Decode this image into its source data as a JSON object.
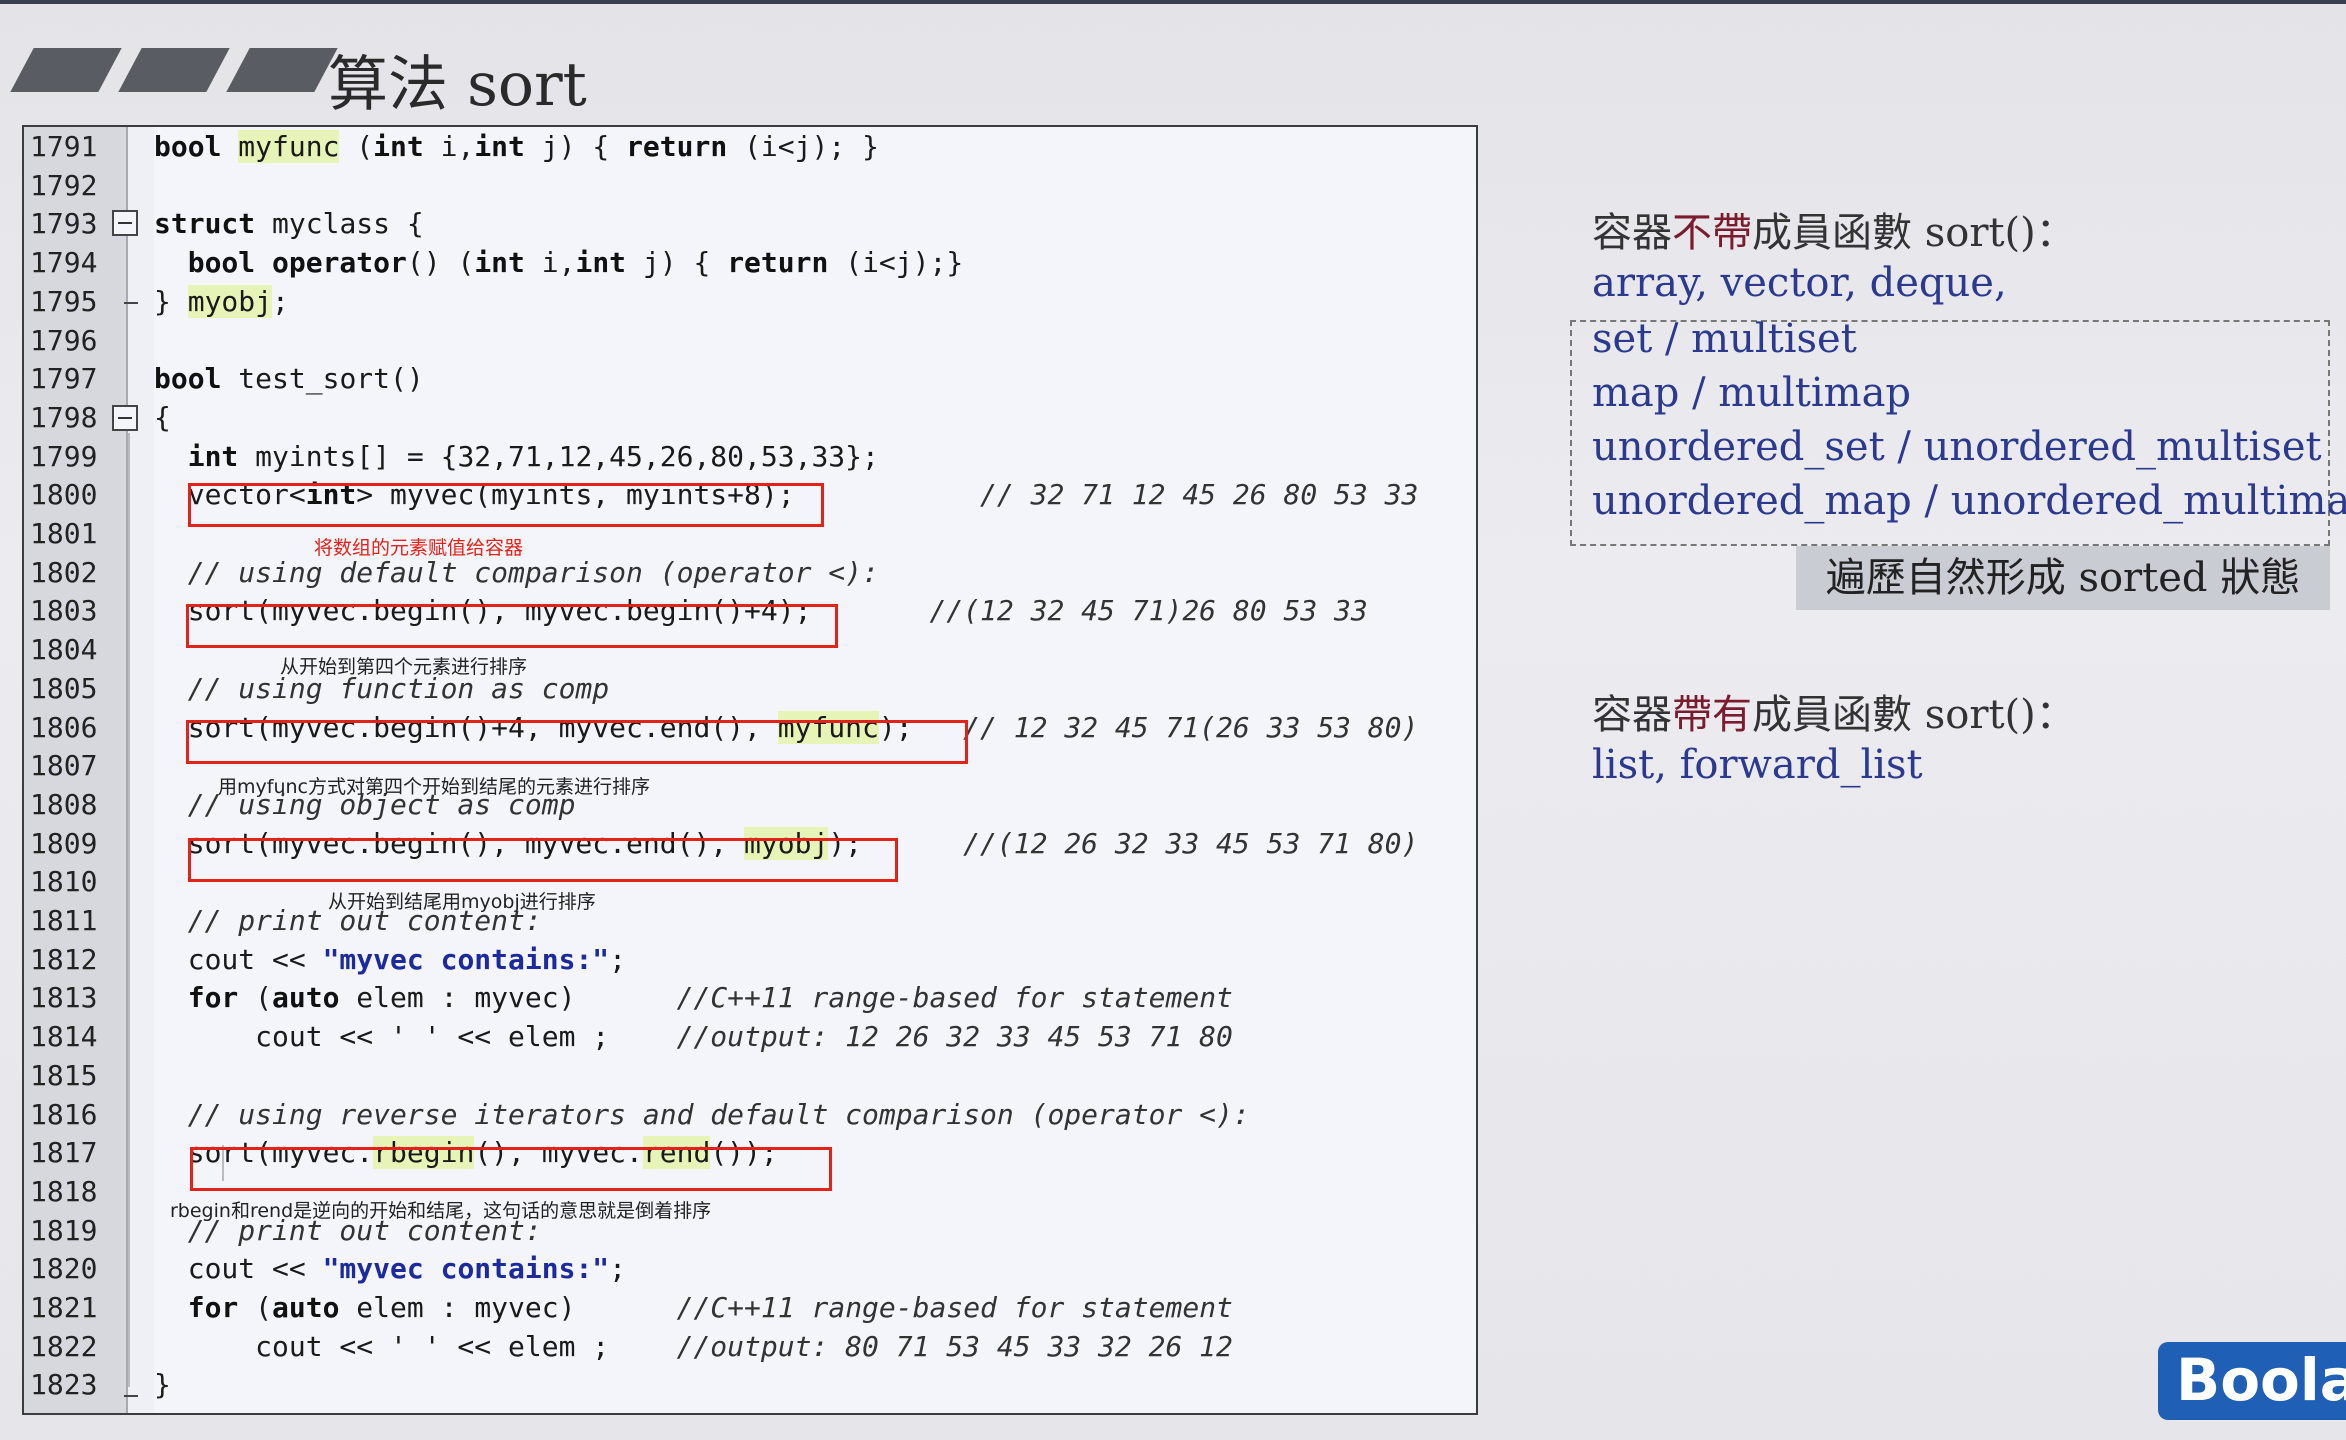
{
  "slide": {
    "title": "算法 sort",
    "accent_dark": "#595d63"
  },
  "code": {
    "lines": [
      {
        "n": "1791",
        "segments": [
          {
            "t": "bool ",
            "c": "kw"
          },
          {
            "t": "myfunc",
            "c": "hl"
          },
          {
            "t": " (",
            "c": ""
          },
          {
            "t": "int",
            "c": "kw"
          },
          {
            "t": " i,",
            "c": ""
          },
          {
            "t": "int",
            "c": "kw"
          },
          {
            "t": " j) { ",
            "c": ""
          },
          {
            "t": "return",
            "c": "kw"
          },
          {
            "t": " (i<j); }",
            "c": ""
          }
        ]
      },
      {
        "n": "1792",
        "segments": []
      },
      {
        "n": "1793",
        "segments": [
          {
            "t": "struct ",
            "c": "kw"
          },
          {
            "t": "myclass {",
            "c": ""
          }
        ]
      },
      {
        "n": "1794",
        "segments": [
          {
            "t": "  bool operator",
            "c": "kw"
          },
          {
            "t": "() (",
            "c": ""
          },
          {
            "t": "int",
            "c": "kw"
          },
          {
            "t": " i,",
            "c": ""
          },
          {
            "t": "int",
            "c": "kw"
          },
          {
            "t": " j) { ",
            "c": ""
          },
          {
            "t": "return",
            "c": "kw"
          },
          {
            "t": " (i<j);}",
            "c": ""
          }
        ]
      },
      {
        "n": "1795",
        "segments": [
          {
            "t": "} ",
            "c": ""
          },
          {
            "t": "myobj",
            "c": "hl"
          },
          {
            "t": ";",
            "c": ""
          }
        ]
      },
      {
        "n": "1796",
        "segments": []
      },
      {
        "n": "1797",
        "segments": [
          {
            "t": "bool ",
            "c": "kw"
          },
          {
            "t": "test_sort()",
            "c": ""
          }
        ]
      },
      {
        "n": "1798",
        "segments": [
          {
            "t": "{",
            "c": ""
          }
        ]
      },
      {
        "n": "1799",
        "segments": [
          {
            "t": "  int ",
            "c": "kw"
          },
          {
            "t": "myints[] = {32,71,12,45,26,80,53,33};",
            "c": ""
          }
        ]
      },
      {
        "n": "1800",
        "segments": [
          {
            "t": "  vector<",
            "c": ""
          },
          {
            "t": "int",
            "c": "kw"
          },
          {
            "t": "> myvec(myints, myints+8);",
            "c": ""
          },
          {
            "t": "           // 32 71 12 45 26 80 53 33",
            "c": "cm"
          }
        ]
      },
      {
        "n": "1801",
        "segments": []
      },
      {
        "n": "1802",
        "segments": [
          {
            "t": "  // using default comparison (operator <):",
            "c": "cm"
          }
        ]
      },
      {
        "n": "1803",
        "segments": [
          {
            "t": "  sort(myvec.begin(), myvec.begin()+4);",
            "c": ""
          },
          {
            "t": "       //(12 32 45 71)26 80 53 33",
            "c": "cm"
          }
        ]
      },
      {
        "n": "1804",
        "segments": []
      },
      {
        "n": "1805",
        "segments": [
          {
            "t": "  // using function as comp",
            "c": "cm"
          }
        ]
      },
      {
        "n": "1806",
        "segments": [
          {
            "t": "  sort(myvec.begin()+4, myvec.end(), ",
            "c": ""
          },
          {
            "t": "myfunc",
            "c": "hl"
          },
          {
            "t": ");",
            "c": ""
          },
          {
            "t": "   // 12 32 45 71(26 33 53 80)",
            "c": "cm"
          }
        ]
      },
      {
        "n": "1807",
        "segments": []
      },
      {
        "n": "1808",
        "segments": [
          {
            "t": "  // using object as comp",
            "c": "cm"
          }
        ]
      },
      {
        "n": "1809",
        "segments": [
          {
            "t": "  sort(myvec.begin(), myvec.end(), ",
            "c": ""
          },
          {
            "t": "myobj",
            "c": "hl"
          },
          {
            "t": ");",
            "c": ""
          },
          {
            "t": "      //(12 26 32 33 45 53 71 80)",
            "c": "cm"
          }
        ]
      },
      {
        "n": "1810",
        "segments": []
      },
      {
        "n": "1811",
        "segments": [
          {
            "t": "  // print out content:",
            "c": "cm"
          }
        ]
      },
      {
        "n": "1812",
        "segments": [
          {
            "t": "  cout << ",
            "c": ""
          },
          {
            "t": "\"myvec contains:\"",
            "c": "str"
          },
          {
            "t": ";",
            "c": ""
          }
        ]
      },
      {
        "n": "1813",
        "segments": [
          {
            "t": "  for ",
            "c": "kw"
          },
          {
            "t": "(",
            "c": ""
          },
          {
            "t": "auto",
            "c": "kw"
          },
          {
            "t": " elem : myvec)",
            "c": ""
          },
          {
            "t": "      //C++11 range-based for statement",
            "c": "cm"
          }
        ]
      },
      {
        "n": "1814",
        "segments": [
          {
            "t": "      cout << ' ' << elem ;",
            "c": ""
          },
          {
            "t": "    //output: 12 26 32 33 45 53 71 80",
            "c": "cm"
          }
        ]
      },
      {
        "n": "1815",
        "segments": []
      },
      {
        "n": "1816",
        "segments": [
          {
            "t": "  // using reverse iterators and default comparison (operator <):",
            "c": "cm"
          }
        ]
      },
      {
        "n": "1817",
        "segments": [
          {
            "t": "  sort(myvec.",
            "c": ""
          },
          {
            "t": "rbegin",
            "c": "hl"
          },
          {
            "t": "(), myvec.",
            "c": ""
          },
          {
            "t": "rend",
            "c": "hl"
          },
          {
            "t": "());",
            "c": ""
          }
        ]
      },
      {
        "n": "1818",
        "segments": []
      },
      {
        "n": "1819",
        "segments": [
          {
            "t": "  // print out content:",
            "c": "cm"
          }
        ]
      },
      {
        "n": "1820",
        "segments": [
          {
            "t": "  cout << ",
            "c": ""
          },
          {
            "t": "\"myvec contains:\"",
            "c": "str"
          },
          {
            "t": ";",
            "c": ""
          }
        ]
      },
      {
        "n": "1821",
        "segments": [
          {
            "t": "  for ",
            "c": "kw"
          },
          {
            "t": "(",
            "c": ""
          },
          {
            "t": "auto",
            "c": "kw"
          },
          {
            "t": " elem : myvec)",
            "c": ""
          },
          {
            "t": "      //C++11 range-based for statement",
            "c": "cm"
          }
        ]
      },
      {
        "n": "1822",
        "segments": [
          {
            "t": "      cout << ' ' << elem ;",
            "c": ""
          },
          {
            "t": "    //output: 80 71 53 45 33 32 26 12",
            "c": "cm"
          }
        ]
      },
      {
        "n": "1823",
        "segments": [
          {
            "t": "}",
            "c": ""
          }
        ]
      }
    ],
    "annotations": {
      "a1800": "将数组的元素赋值给容器",
      "a1803": "从开始到第四个元素进行排序",
      "a1806": "用myfunc方式对第四个开始到结尾的元素进行排序",
      "a1809": "从开始到结尾用myobj进行排序",
      "a1817": "rbegin和rend是逆向的开始和结尾，这句话的意思就是倒着排序"
    },
    "highlight_color": "#e2231a"
  },
  "right": {
    "h1_pre": "容器",
    "h1_em": "不帶",
    "h1_post": "成員函數 sort()：",
    "list1": [
      "array, vector, deque,",
      "set / multiset",
      "map / multimap",
      "unordered_set / unordered_multiset",
      "unordered_map / unordered_multimap"
    ],
    "badge": "遍歷自然形成 sorted 狀態",
    "h2_pre": "容器",
    "h2_em": "帶有",
    "h2_post": "成員函數 sort()：",
    "list2": [
      "list, forward_list"
    ]
  },
  "logo": {
    "text": "Boolar"
  }
}
